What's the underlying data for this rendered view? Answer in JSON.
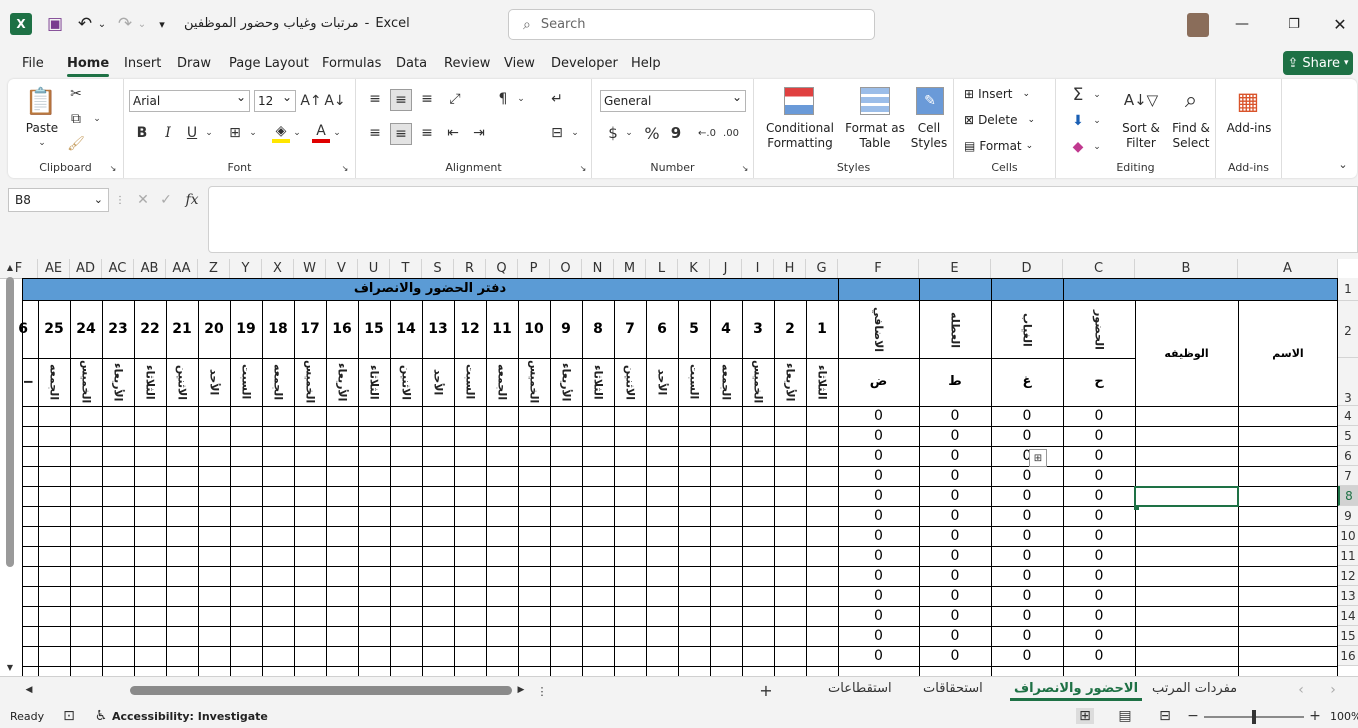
{
  "titlebar": {
    "doc_title": "مرتبات وغياب وحضور الموظفين",
    "separator": "-",
    "app_name": "Excel",
    "search_placeholder": "Search"
  },
  "menu": [
    "File",
    "Home",
    "Insert",
    "Draw",
    "Page Layout",
    "Formulas",
    "Data",
    "Review",
    "View",
    "Developer",
    "Help"
  ],
  "share_label": "Share",
  "ribbon": {
    "clipboard": {
      "paste": "Paste",
      "label": "Clipboard"
    },
    "font": {
      "name": "Arial",
      "size": "12",
      "bold": "B",
      "italic": "I",
      "underline": "U",
      "label": "Font"
    },
    "alignment": {
      "label": "Alignment"
    },
    "number": {
      "format": "General",
      "currency": "$",
      "percent": "%",
      "comma": "9",
      "label": "Number"
    },
    "styles": {
      "conditional_1": "Conditional",
      "conditional_2": "Formatting",
      "format_table_1": "Format as",
      "format_table_2": "Table",
      "cell_styles_1": "Cell",
      "cell_styles_2": "Styles",
      "label": "Styles"
    },
    "cells": {
      "insert": "Insert",
      "delete": "Delete",
      "format": "Format",
      "label": "Cells"
    },
    "editing": {
      "sort_1": "Sort &",
      "sort_2": "Filter",
      "find_1": "Find &",
      "find_2": "Select",
      "label": "Editing"
    },
    "addins": {
      "button": "Add-ins",
      "label": "Add-ins"
    }
  },
  "formula_bar": {
    "name_box": "B8",
    "fx": "fx",
    "formula": ""
  },
  "columns_right": [
    "A",
    "B",
    "C",
    "D",
    "E",
    "F"
  ],
  "columns_days": [
    "G",
    "H",
    "I",
    "J",
    "K",
    "L",
    "M",
    "N",
    "O",
    "P",
    "Q",
    "R",
    "S",
    "T",
    "U",
    "V",
    "W",
    "X",
    "Y",
    "Z",
    "AA",
    "AB",
    "AC",
    "AD",
    "AE",
    "F"
  ],
  "row_numbers": [
    "1",
    "2",
    "3",
    "4",
    "5",
    "6",
    "7",
    "8",
    "9",
    "10",
    "11",
    "12",
    "13",
    "14",
    "15",
    "16"
  ],
  "sheet": {
    "title": "دفتر الحضور والانصراف",
    "name_header": "الاسم",
    "job_header": "الوظيفه",
    "summary_headers": [
      "الحضور",
      "الغياب",
      "العطله",
      "الاضافي"
    ],
    "summary_codes": [
      "ح",
      "غ",
      "ط",
      "ض"
    ],
    "day_numbers": [
      "1",
      "2",
      "3",
      "4",
      "5",
      "6",
      "7",
      "8",
      "9",
      "10",
      "11",
      "12",
      "13",
      "14",
      "15",
      "16",
      "17",
      "18",
      "19",
      "20",
      "21",
      "22",
      "23",
      "24",
      "25",
      "6"
    ],
    "weekdays": [
      "الثلاثاء",
      "الأربعاء",
      "الخميس",
      "الجمعه",
      "السبت",
      "الأحد",
      "الاثنين",
      "الثلاثاء",
      "الأربعاء",
      "الخميس",
      "الجمعه",
      "السبت",
      "الأحد",
      "الاثنين",
      "الثلاثاء",
      "الأربعاء",
      "الخميس",
      "الجمعه",
      "السبت",
      "الأحد",
      "الاثنين",
      "الثلاثاء",
      "الأربعاء",
      "الخميس",
      "الجمعه",
      "ا"
    ],
    "zero_value": "0"
  },
  "tabs": [
    "مفردات المرتب",
    "الاحضور والانصراف",
    "استحقاقات",
    "استقطاعات"
  ],
  "status": {
    "ready": "Ready",
    "accessibility": "Accessibility: Investigate",
    "zoom": "100%"
  },
  "colors": {
    "accent": "#1e7145",
    "banner": "#5b9bd5"
  }
}
